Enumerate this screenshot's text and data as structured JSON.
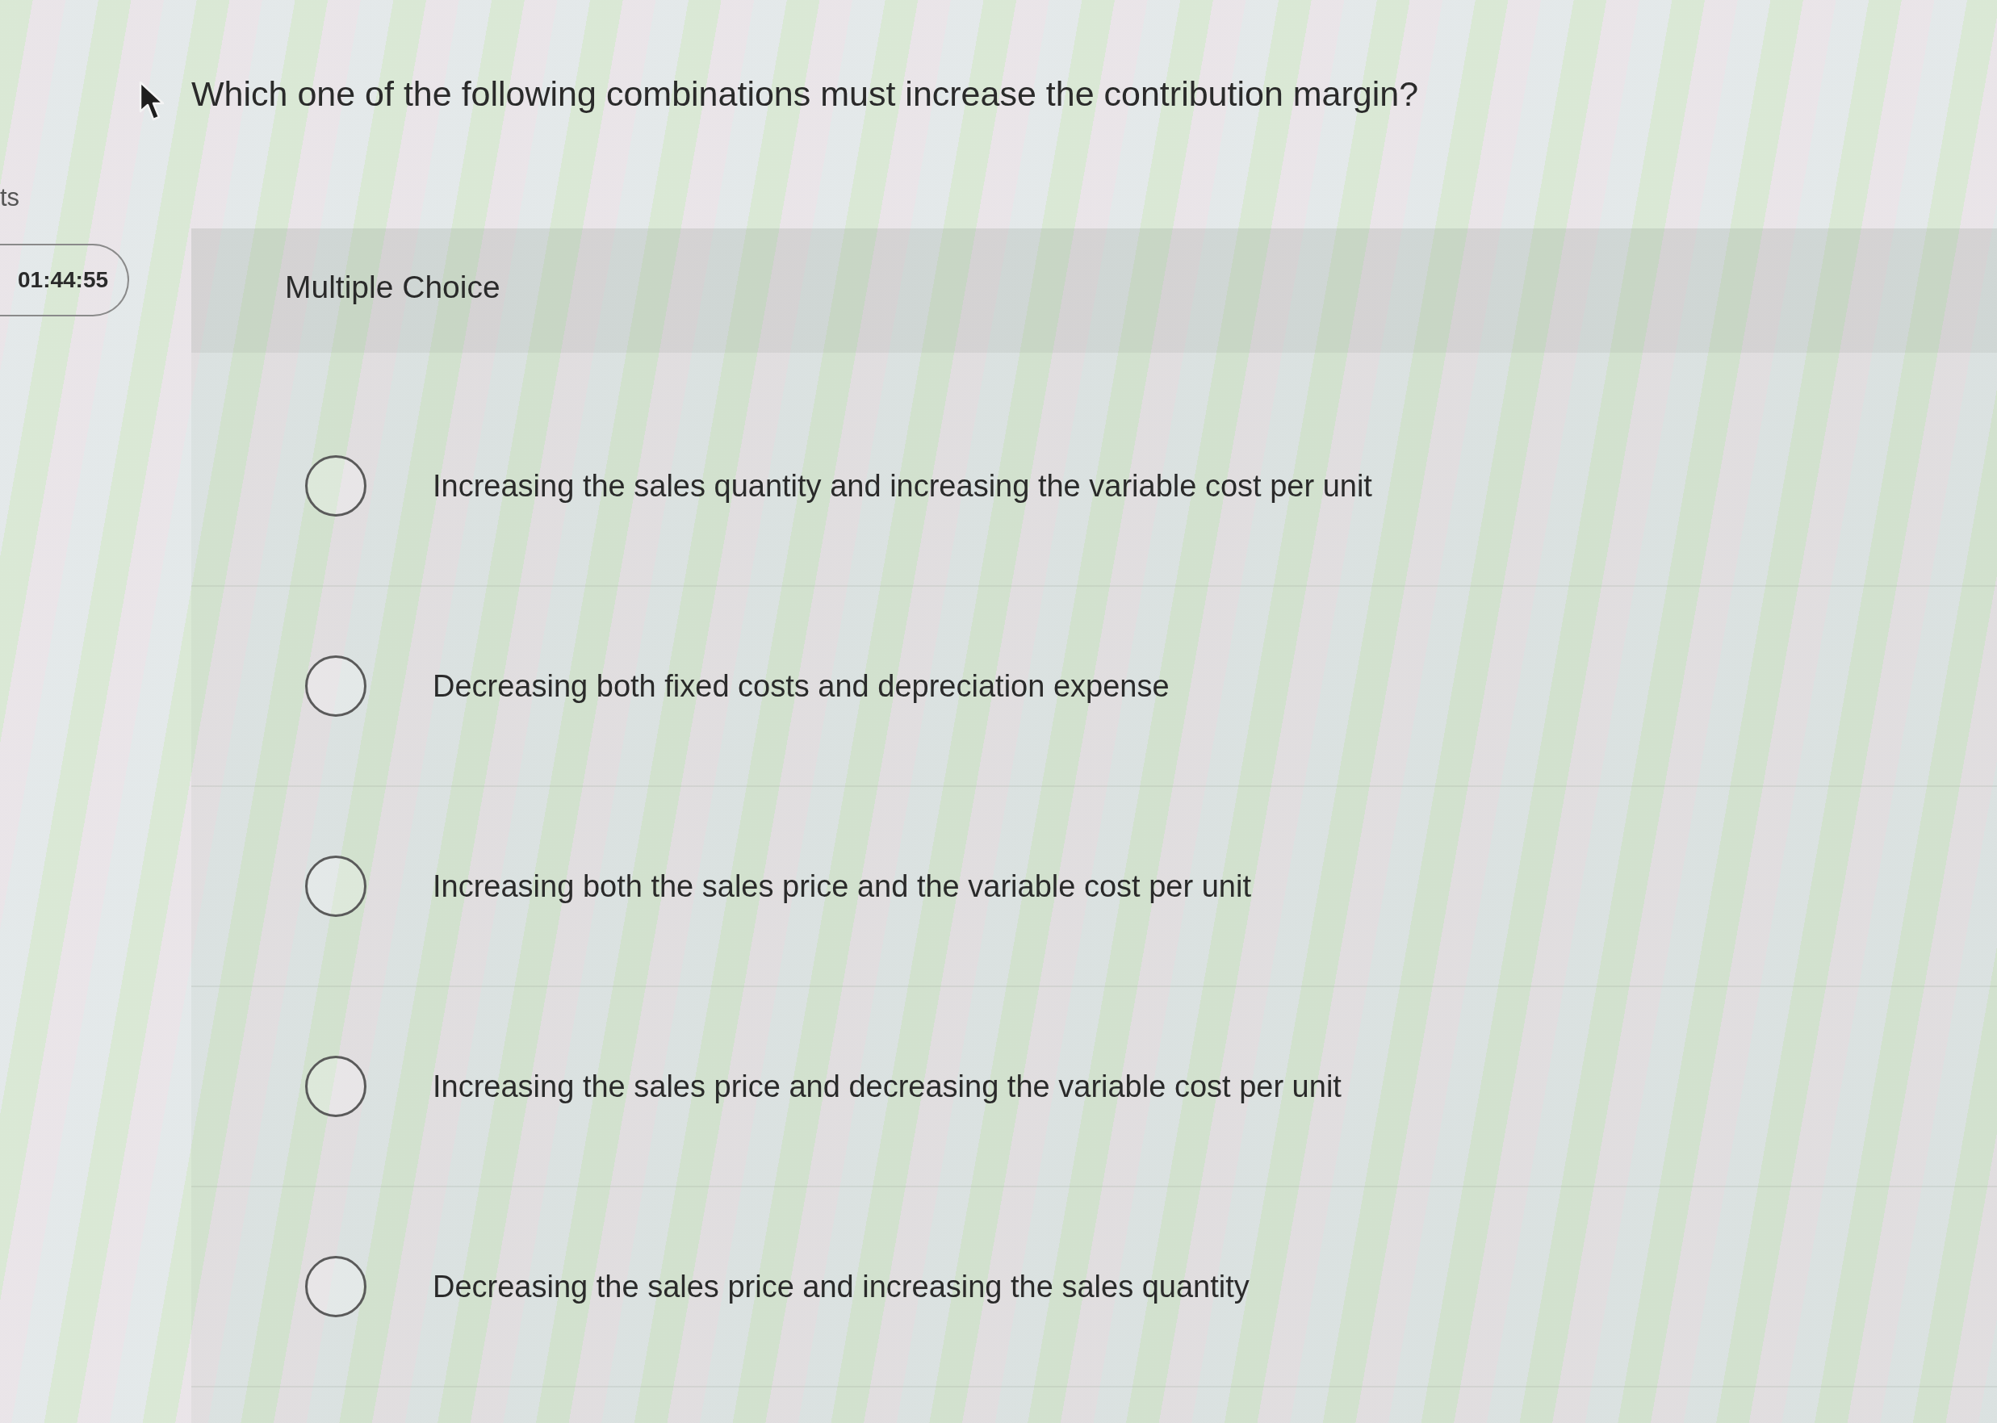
{
  "side_label": "ts",
  "timer": "01:44:55",
  "question": "Which one of the following combinations must increase the contribution margin?",
  "answer_panel": {
    "header": "Multiple Choice",
    "options": [
      {
        "label": "Increasing the sales quantity and increasing the variable cost per unit",
        "selected": false
      },
      {
        "label": "Decreasing both fixed costs and depreciation expense",
        "selected": false
      },
      {
        "label": "Increasing both the sales price and the variable cost per unit",
        "selected": false
      },
      {
        "label": "Increasing the sales price and decreasing the variable cost per unit",
        "selected": false
      },
      {
        "label": "Decreasing the sales price and increasing the sales quantity",
        "selected": false
      }
    ]
  }
}
